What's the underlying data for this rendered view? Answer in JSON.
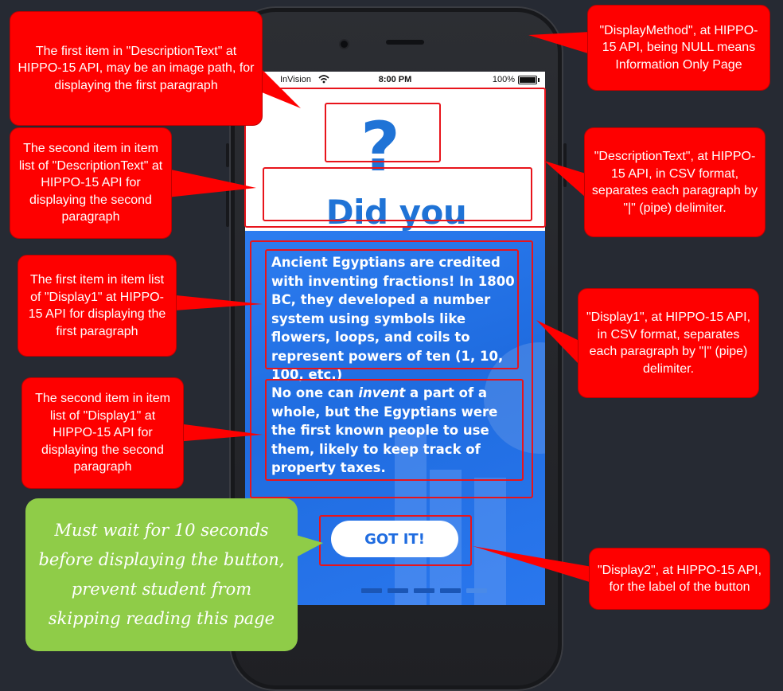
{
  "phone": {
    "status_bar": {
      "carrier": "InVision",
      "time": "8:00 PM",
      "battery": "100%"
    }
  },
  "screen": {
    "icon_text": "?",
    "heading": "Did you know?",
    "paragraph_1": "Ancient Egyptians are credited with inventing fractions! In 1800 BC, they developed a number system using symbols like flowers, loops, and coils to represent powers of ten (1, 10, 100, etc.)",
    "paragraph_2_before": "No one can ",
    "paragraph_2_emphasis": "invent",
    "paragraph_2_after": " a part of a whole, but the Egyptians were the first known people to use them, likely to keep track of property taxes.",
    "button_label": "GOT IT!",
    "page_indicator_count": 5
  },
  "callouts": {
    "description_first": "The first item in \"DescriptionText\" at HIPPO-15 API, may be an image path, for displaying  the first paragraph",
    "description_second": "The second item in item list of \"DescriptionText\" at HIPPO-15 API for displaying  the second paragraph",
    "display1_first": "The first item in item list of \"Display1\" at HIPPO-15 API for displaying  the first paragraph",
    "display1_second": "The second item in item list of \"Display1\" at HIPPO-15 API for displaying  the second paragraph",
    "wait_note": "Must wait for 10 seconds before displaying the button, prevent student from skipping reading this page",
    "display_method": "\"DisplayMethod\", at HIPPO-15 API, being NULL means Information Only Page",
    "description_text": "\"DescriptionText\", at HIPPO-15 API, in CSV format, separates each paragraph by \"|\" (pipe) delimiter.",
    "display1": "\"Display1\", at HIPPO-15 API, in CSV format, separates each paragraph by \"|\" (pipe) delimiter.",
    "display2": "\"Display2\", at HIPPO-15 API, for the label of the button"
  },
  "colors": {
    "callout_red": "#fe0000",
    "callout_green": "#8fcc48",
    "brand_blue": "#1f73d6",
    "background": "#262a33"
  }
}
